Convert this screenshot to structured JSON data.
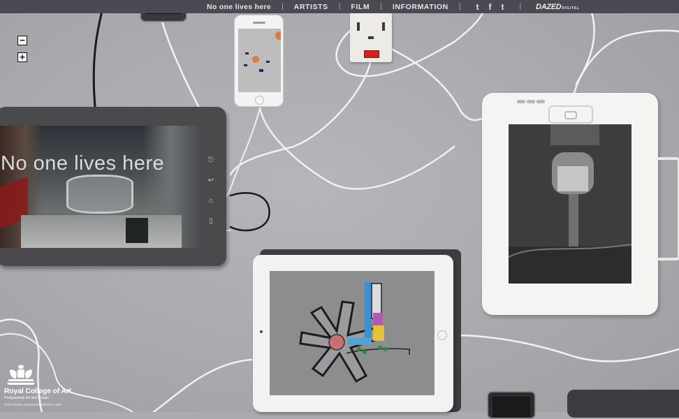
{
  "nav": {
    "brand": "No one lives here",
    "links": [
      "ARTISTS",
      "FILM",
      "INFORMATION"
    ],
    "separator": "|",
    "social": [
      {
        "glyph": "t",
        "icon": "twitter-icon"
      },
      {
        "glyph": "f",
        "icon": "facebook-icon"
      },
      {
        "glyph": "t",
        "icon": "tumblr-icon"
      }
    ],
    "partner": "DAZED",
    "partner_suffix": "DIGITAL"
  },
  "zoom": {
    "out_glyph": "−",
    "in_glyph": "+",
    "out_icon": "minus-icon",
    "in_icon": "plus-icon"
  },
  "tablet_screen": {
    "title": "No one lives here",
    "buttons": [
      "⎋",
      "↩",
      "⌂",
      "▯"
    ]
  },
  "footer_logo": {
    "name": "Royal College of Art",
    "line1": "Postgraduate Art and Design",
    "line2": "CURATING CONTEMPORARY ART",
    "icon": "royal-crest-icon"
  },
  "colors": {
    "nav_bg": "#4a4b52",
    "table": "#a9abaf",
    "switch_red": "#d32020"
  }
}
